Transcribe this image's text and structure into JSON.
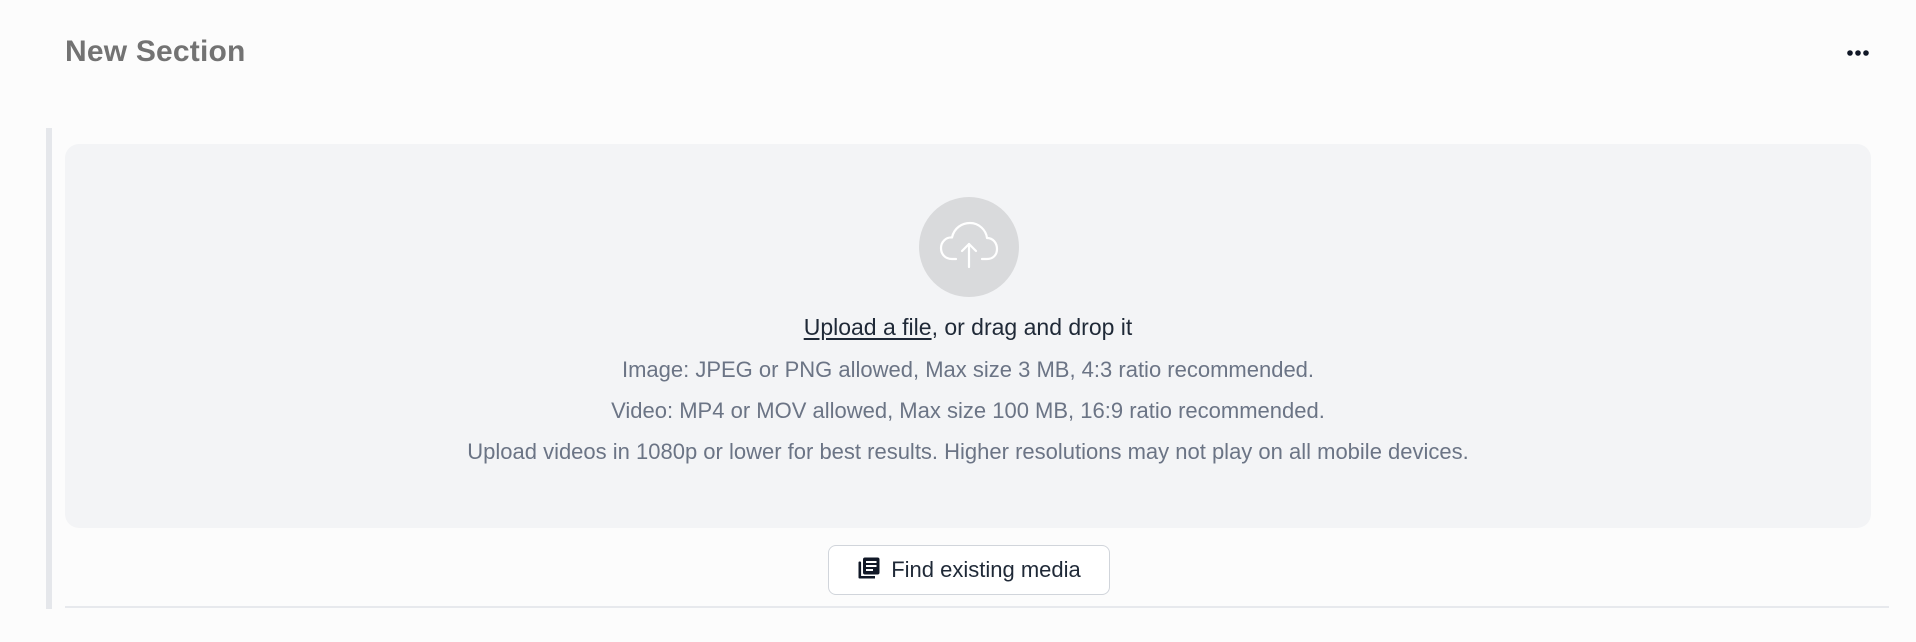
{
  "section": {
    "title": "New Section",
    "more_icon": "more-horizontal-icon"
  },
  "dropzone": {
    "icon": "cloud-upload-icon",
    "upload_link": "Upload a file",
    "upload_suffix": ", or drag and drop it",
    "image_info": "Image: JPEG or PNG allowed, Max size 3 MB, 4:3 ratio recommended.",
    "video_info": "Video: MP4 or MOV allowed, Max size 100 MB, 16:9 ratio recommended.",
    "resolution_info": "Upload videos in 1080p or lower for best results. Higher resolutions may not play on all mobile devices."
  },
  "find_media": {
    "label": "Find existing media",
    "icon": "media-library-icon"
  },
  "colors": {
    "dropzone_bg": "#f3f4f6",
    "title": "#737373",
    "info_text": "#6b7485",
    "primary_text": "#1f2937"
  }
}
